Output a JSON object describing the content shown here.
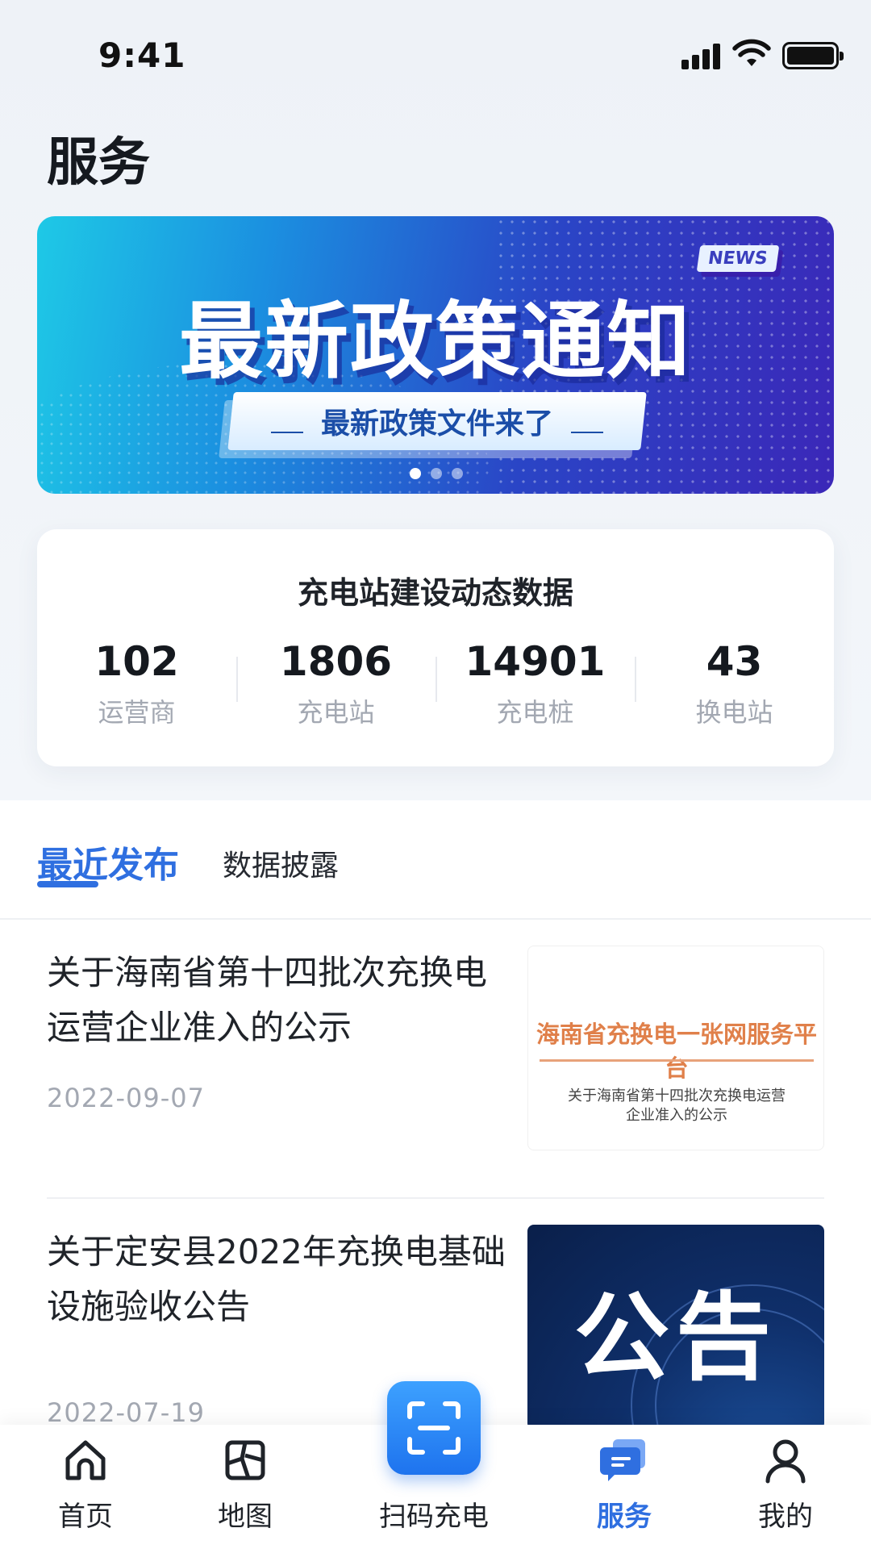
{
  "status_bar": {
    "time": "9:41"
  },
  "page": {
    "title": "服务"
  },
  "banner": {
    "badge": "NEWS",
    "headline": "最新政策通知",
    "subtitle": "最新政策文件来了",
    "page_count": 3,
    "active_page": 1
  },
  "stats": {
    "title": "充电站建设动态数据",
    "items": [
      {
        "value": "102",
        "label": "运营商"
      },
      {
        "value": "1806",
        "label": "充电站"
      },
      {
        "value": "14901",
        "label": "充电桩"
      },
      {
        "value": "43",
        "label": "换电站"
      }
    ]
  },
  "tabs": [
    {
      "label": "最近发布",
      "active": true
    },
    {
      "label": "数据披露",
      "active": false
    }
  ],
  "news": [
    {
      "title": "关于海南省第十四批次充换电运营企业准入的公示",
      "date": "2022-09-07",
      "thumb_heading": "海南省充换电一张网服务平台",
      "thumb_sub_1": "关于海南省第十四批次充换电运营",
      "thumb_sub_2": "企业准入的公示"
    },
    {
      "title": "关于定安县2022年充换电基础设施验收公告",
      "date": "2022-07-19",
      "thumb_heading": "公告"
    }
  ],
  "bottom_nav": {
    "items": [
      {
        "label": "首页",
        "icon": "home-icon"
      },
      {
        "label": "地图",
        "icon": "map-icon"
      },
      {
        "label": "扫码充电",
        "icon": "scan-icon"
      },
      {
        "label": "服务",
        "icon": "service-icon",
        "active": true
      },
      {
        "label": "我的",
        "icon": "user-icon"
      }
    ]
  },
  "colors": {
    "accent": "#2f6fe0",
    "muted_text": "#a3a8b2",
    "scan_button": "#1e73ee"
  }
}
